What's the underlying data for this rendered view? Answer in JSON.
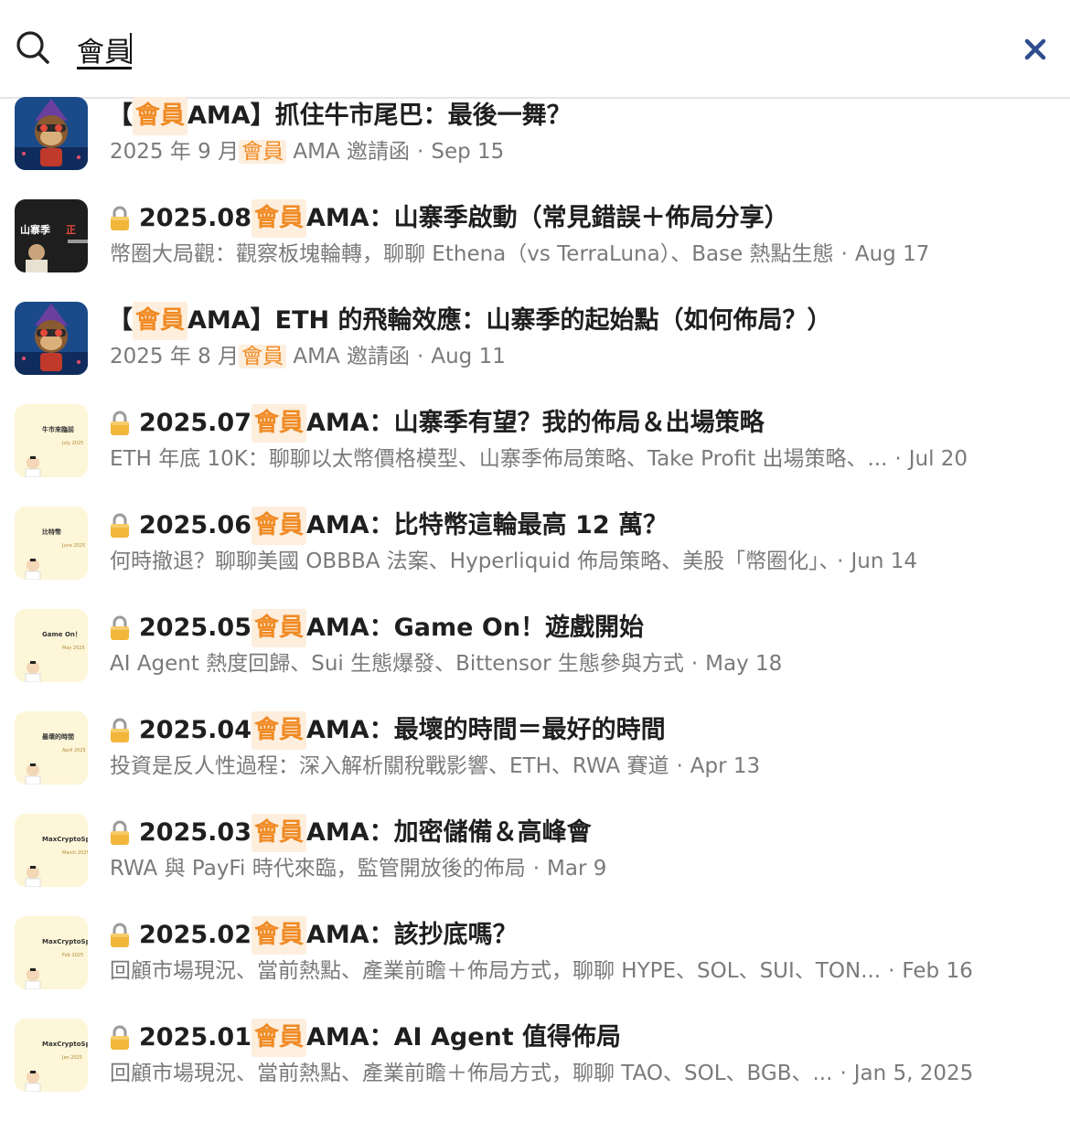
{
  "search": {
    "query": "會員"
  },
  "colors": {
    "highlight_text": "#f08a24",
    "highlight_bg": "#fdeedd",
    "close_icon": "#2f4d8f"
  },
  "results": [
    {
      "thumb": "monkey-avatar",
      "locked": false,
      "title_pre": "【",
      "title_hl": "會員",
      "title_post": " AMA】抓住牛市尾巴：最後一舞？",
      "sub_pre": "2025 年 9 月",
      "sub_hl": "會員",
      "sub_post": " AMA 邀請函",
      "date": "Sep 15"
    },
    {
      "thumb": "video-thumbnail",
      "thumb_text": "山寨季",
      "thumb_accent": "正",
      "locked": true,
      "title_pre": "2025.08 ",
      "title_hl": "會員",
      "title_post": " AMA：山寨季啟動（常見錯誤＋佈局分享）",
      "sub_pre": "幣圈大局觀：觀察板塊輪轉，聊聊 Ethena（vs TerraLuna）、Base 熱點生態",
      "sub_hl": "",
      "sub_post": "",
      "date": "Aug 17"
    },
    {
      "thumb": "monkey-avatar",
      "locked": false,
      "title_pre": "【",
      "title_hl": "會員",
      "title_post": " AMA】ETH 的飛輪效應：山寨季的起始點（如何佈局？）",
      "sub_pre": "2025 年 8 月",
      "sub_hl": "會員",
      "sub_post": " AMA 邀請函",
      "date": "Aug 11"
    },
    {
      "thumb": "yellow-card",
      "thumb_text": "牛市來臨前",
      "thumb_sub": "July 2025",
      "locked": true,
      "title_pre": "2025.07 ",
      "title_hl": "會員",
      "title_post": " AMA：山寨季有望？我的佈局＆出場策略",
      "sub_pre": "ETH 年底 10K：聊聊以太幣價格模型、山寨季佈局策略、Take Profit 出場策略、...",
      "sub_hl": "",
      "sub_post": "",
      "date": "Jul 20"
    },
    {
      "thumb": "yellow-card",
      "thumb_text": "比特幣",
      "thumb_sub": "June 2025",
      "locked": true,
      "title_pre": "2025.06 ",
      "title_hl": "會員",
      "title_post": " AMA：比特幣這輪最高 12 萬？",
      "sub_pre": "何時撤退？聊聊美國 OBBBA 法案、Hyperliquid 佈局策略、美股「幣圈化」、",
      "sub_hl": "",
      "sub_post": "",
      "date": "Jun 14"
    },
    {
      "thumb": "yellow-card",
      "thumb_text": "Game On！",
      "thumb_sub": "May 2025",
      "locked": true,
      "title_pre": "2025.05 ",
      "title_hl": "會員",
      "title_post": " AMA：Game On！遊戲開始",
      "sub_pre": "AI Agent 熱度回歸、Sui 生態爆發、Bittensor 生態參與方式",
      "sub_hl": "",
      "sub_post": "",
      "date": "May 18"
    },
    {
      "thumb": "yellow-card",
      "thumb_text": "最壞的時間",
      "thumb_sub": "April 2025",
      "locked": true,
      "title_pre": "2025.04 ",
      "title_hl": "會員",
      "title_post": " AMA：最壞的時間＝最好的時間",
      "sub_pre": "投資是反人性過程：深入解析關稅戰影響、ETH、RWA 賽道",
      "sub_hl": "",
      "sub_post": "",
      "date": "Apr 13"
    },
    {
      "thumb": "yellow-card",
      "thumb_text": "MaxCryptoSpa",
      "thumb_sub": "March 2025",
      "locked": true,
      "title_pre": "2025.03 ",
      "title_hl": "會員",
      "title_post": " AMA：加密儲備＆高峰會",
      "sub_pre": "RWA 與 PayFi 時代來臨，監管開放後的佈局",
      "sub_hl": "",
      "sub_post": "",
      "date": "Mar 9"
    },
    {
      "thumb": "yellow-card",
      "thumb_text": "MaxCryptoSpa",
      "thumb_sub": "Feb 2025",
      "locked": true,
      "title_pre": "2025.02 ",
      "title_hl": "會員",
      "title_post": " AMA：該抄底嗎？",
      "sub_pre": "回顧市場現況、當前熱點、產業前瞻＋佈局方式，聊聊 HYPE、SOL、SUI、TON...",
      "sub_hl": "",
      "sub_post": "",
      "date": "Feb 16"
    },
    {
      "thumb": "yellow-card",
      "thumb_text": "MaxCryptoSpa",
      "thumb_sub": "Jan 2025",
      "locked": true,
      "title_pre": "2025.01 ",
      "title_hl": "會員",
      "title_post": " AMA：AI Agent 值得佈局",
      "sub_pre": "回顧市場現況、當前熱點、產業前瞻＋佈局方式，聊聊 TAO、SOL、BGB、...",
      "sub_hl": "",
      "sub_post": "",
      "date": "Jan 5, 2025"
    }
  ]
}
